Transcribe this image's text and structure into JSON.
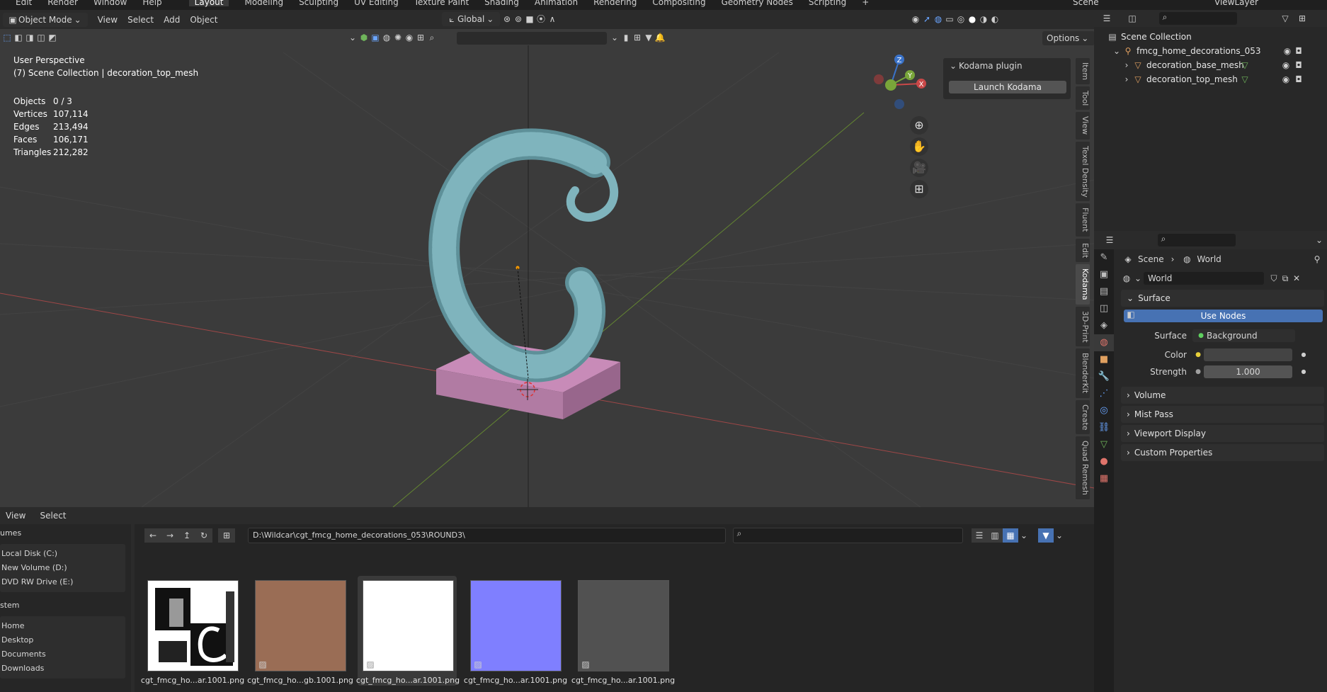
{
  "topbar": {
    "menu": [
      "Edit",
      "Render",
      "Window",
      "Help"
    ],
    "tabs": [
      "Layout",
      "Modeling",
      "Sculpting",
      "UV Editing",
      "Texture Paint",
      "Shading",
      "Animation",
      "Rendering",
      "Compositing",
      "Geometry Nodes",
      "Scripting",
      "+"
    ],
    "active_tab": "Layout",
    "scene_name": "Scene",
    "view_layer": "ViewLayer"
  },
  "viewport": {
    "mode": "Object Mode",
    "menu": [
      "View",
      "Select",
      "Add",
      "Object"
    ],
    "orientation": "Global",
    "options_label": "Options",
    "perspective": "User Perspective",
    "collection_path": "(7) Scene Collection | decoration_top_mesh",
    "stats": [
      {
        "k": "Objects",
        "v": "0 / 3"
      },
      {
        "k": "Vertices",
        "v": "107,114"
      },
      {
        "k": "Edges",
        "v": "213,494"
      },
      {
        "k": "Faces",
        "v": "106,171"
      },
      {
        "k": "Triangles",
        "v": "212,282"
      }
    ],
    "gizmo_axes": {
      "x": "X",
      "y": "Y",
      "z": "Z"
    },
    "plugin_panel": {
      "title": "Kodama plugin",
      "button": "Launch Kodama"
    },
    "side_tabs": [
      "Item",
      "Tool",
      "View",
      "Texel Density",
      "Fluent",
      "Edit",
      "Kodama",
      "3D-Print",
      "BlenderKit",
      "Create",
      "Quad Remesh"
    ],
    "active_side_tab": "Kodama",
    "colors": {
      "mesh_top": "#7fb4bd",
      "mesh_base": "#c88bb8",
      "axis_x": "#b84a4a",
      "axis_y": "#6f9a2f"
    }
  },
  "outliner": {
    "root": "Scene Collection",
    "collection": "fmcg_home_decorations_053",
    "objects": [
      "decoration_base_mesh",
      "decoration_top_mesh"
    ]
  },
  "properties": {
    "breadcrumb": [
      "Scene",
      "World"
    ],
    "world_name": "World",
    "surface_section": "Surface",
    "use_nodes": "Use Nodes",
    "rows": [
      {
        "label": "Surface",
        "value": "Background"
      },
      {
        "label": "Color",
        "value": ""
      },
      {
        "label": "Strength",
        "value": "1.000"
      }
    ],
    "collapsed_sections": [
      "Volume",
      "Mist Pass",
      "Viewport Display",
      "Custom Properties"
    ],
    "accent": "#4772b3"
  },
  "filebrowser": {
    "menu": [
      "View",
      "Select"
    ],
    "path": "D:\\Wildcar\\cgt_fmcg_home_decorations_053\\ROUND3\\",
    "volumes_header": "umes",
    "volumes": [
      "Local Disk (C:)",
      "New Volume (D:)",
      "DVD RW Drive (E:)"
    ],
    "system_header": "stem",
    "system": [
      "Home",
      "Desktop",
      "Documents",
      "Downloads"
    ],
    "files": [
      {
        "name": "cgt_fmcg_ho...ar.1001.png",
        "color": "#ffffff"
      },
      {
        "name": "cgt_fmcg_ho...gb.1001.png",
        "color": "#9a6d55"
      },
      {
        "name": "cgt_fmcg_ho...ar.1001.png",
        "color": "#ffffff"
      },
      {
        "name": "cgt_fmcg_ho...ar.1001.png",
        "color": "#7f7fff"
      },
      {
        "name": "cgt_fmcg_ho...ar.1001.png",
        "color": "#515151"
      }
    ]
  }
}
